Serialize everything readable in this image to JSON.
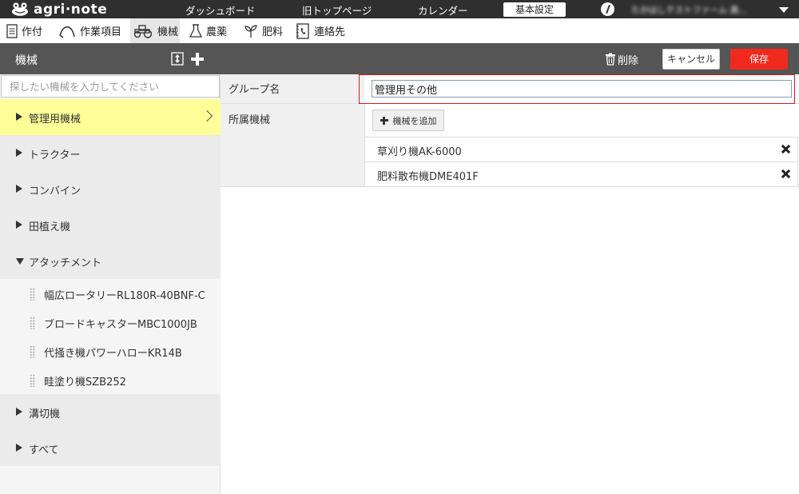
{
  "app": {
    "logo_text": "agri·note",
    "colors": {
      "topbar": "#2f2f2f",
      "header": "#555555",
      "accent_save": "#f22a1d",
      "selected_row": "#ffff99",
      "focus_border": "#d9161e"
    }
  },
  "topnav": {
    "items": [
      "ダッシュボード",
      "旧トップページ",
      "カレンダー"
    ],
    "settings_button": "基本設定",
    "user_name": "たかはしテストファーム 高..."
  },
  "subnav": {
    "items": [
      {
        "label": "作付",
        "icon": "document-icon"
      },
      {
        "label": "作業項目",
        "icon": "sickle-icon"
      },
      {
        "label": "機械",
        "icon": "tractor-icon",
        "active": true
      },
      {
        "label": "農薬",
        "icon": "flask-icon"
      },
      {
        "label": "肥料",
        "icon": "sprout-icon"
      },
      {
        "label": "連絡先",
        "icon": "phonebook-icon"
      }
    ]
  },
  "header": {
    "title": "機械",
    "delete_label": "削除",
    "cancel_label": "キャンセル",
    "save_label": "保存"
  },
  "sidebar": {
    "search_placeholder": "探したい機械を入力してください",
    "groups": [
      {
        "label": "管理用機械",
        "expanded": false,
        "selected": true
      },
      {
        "label": "トラクター",
        "expanded": false
      },
      {
        "label": "コンバイン",
        "expanded": false
      },
      {
        "label": "田植え機",
        "expanded": false
      },
      {
        "label": "アタッチメント",
        "expanded": true,
        "children": [
          "幅広ロータリーRL180R-40BNF-C",
          "ブロードキャスターMBC1000JB",
          "代掻き機パワーハローKR14B",
          "畦塗り機SZB252"
        ]
      },
      {
        "label": "溝切機",
        "expanded": false
      },
      {
        "label": "すべて",
        "expanded": false
      }
    ]
  },
  "form": {
    "group_name_label": "グループ名",
    "group_name_value": "管理用その他",
    "machines_label": "所属機械",
    "add_machine_label": "機械を追加",
    "machines": [
      "草刈り機AK-6000",
      "肥料散布機DME401F"
    ]
  }
}
